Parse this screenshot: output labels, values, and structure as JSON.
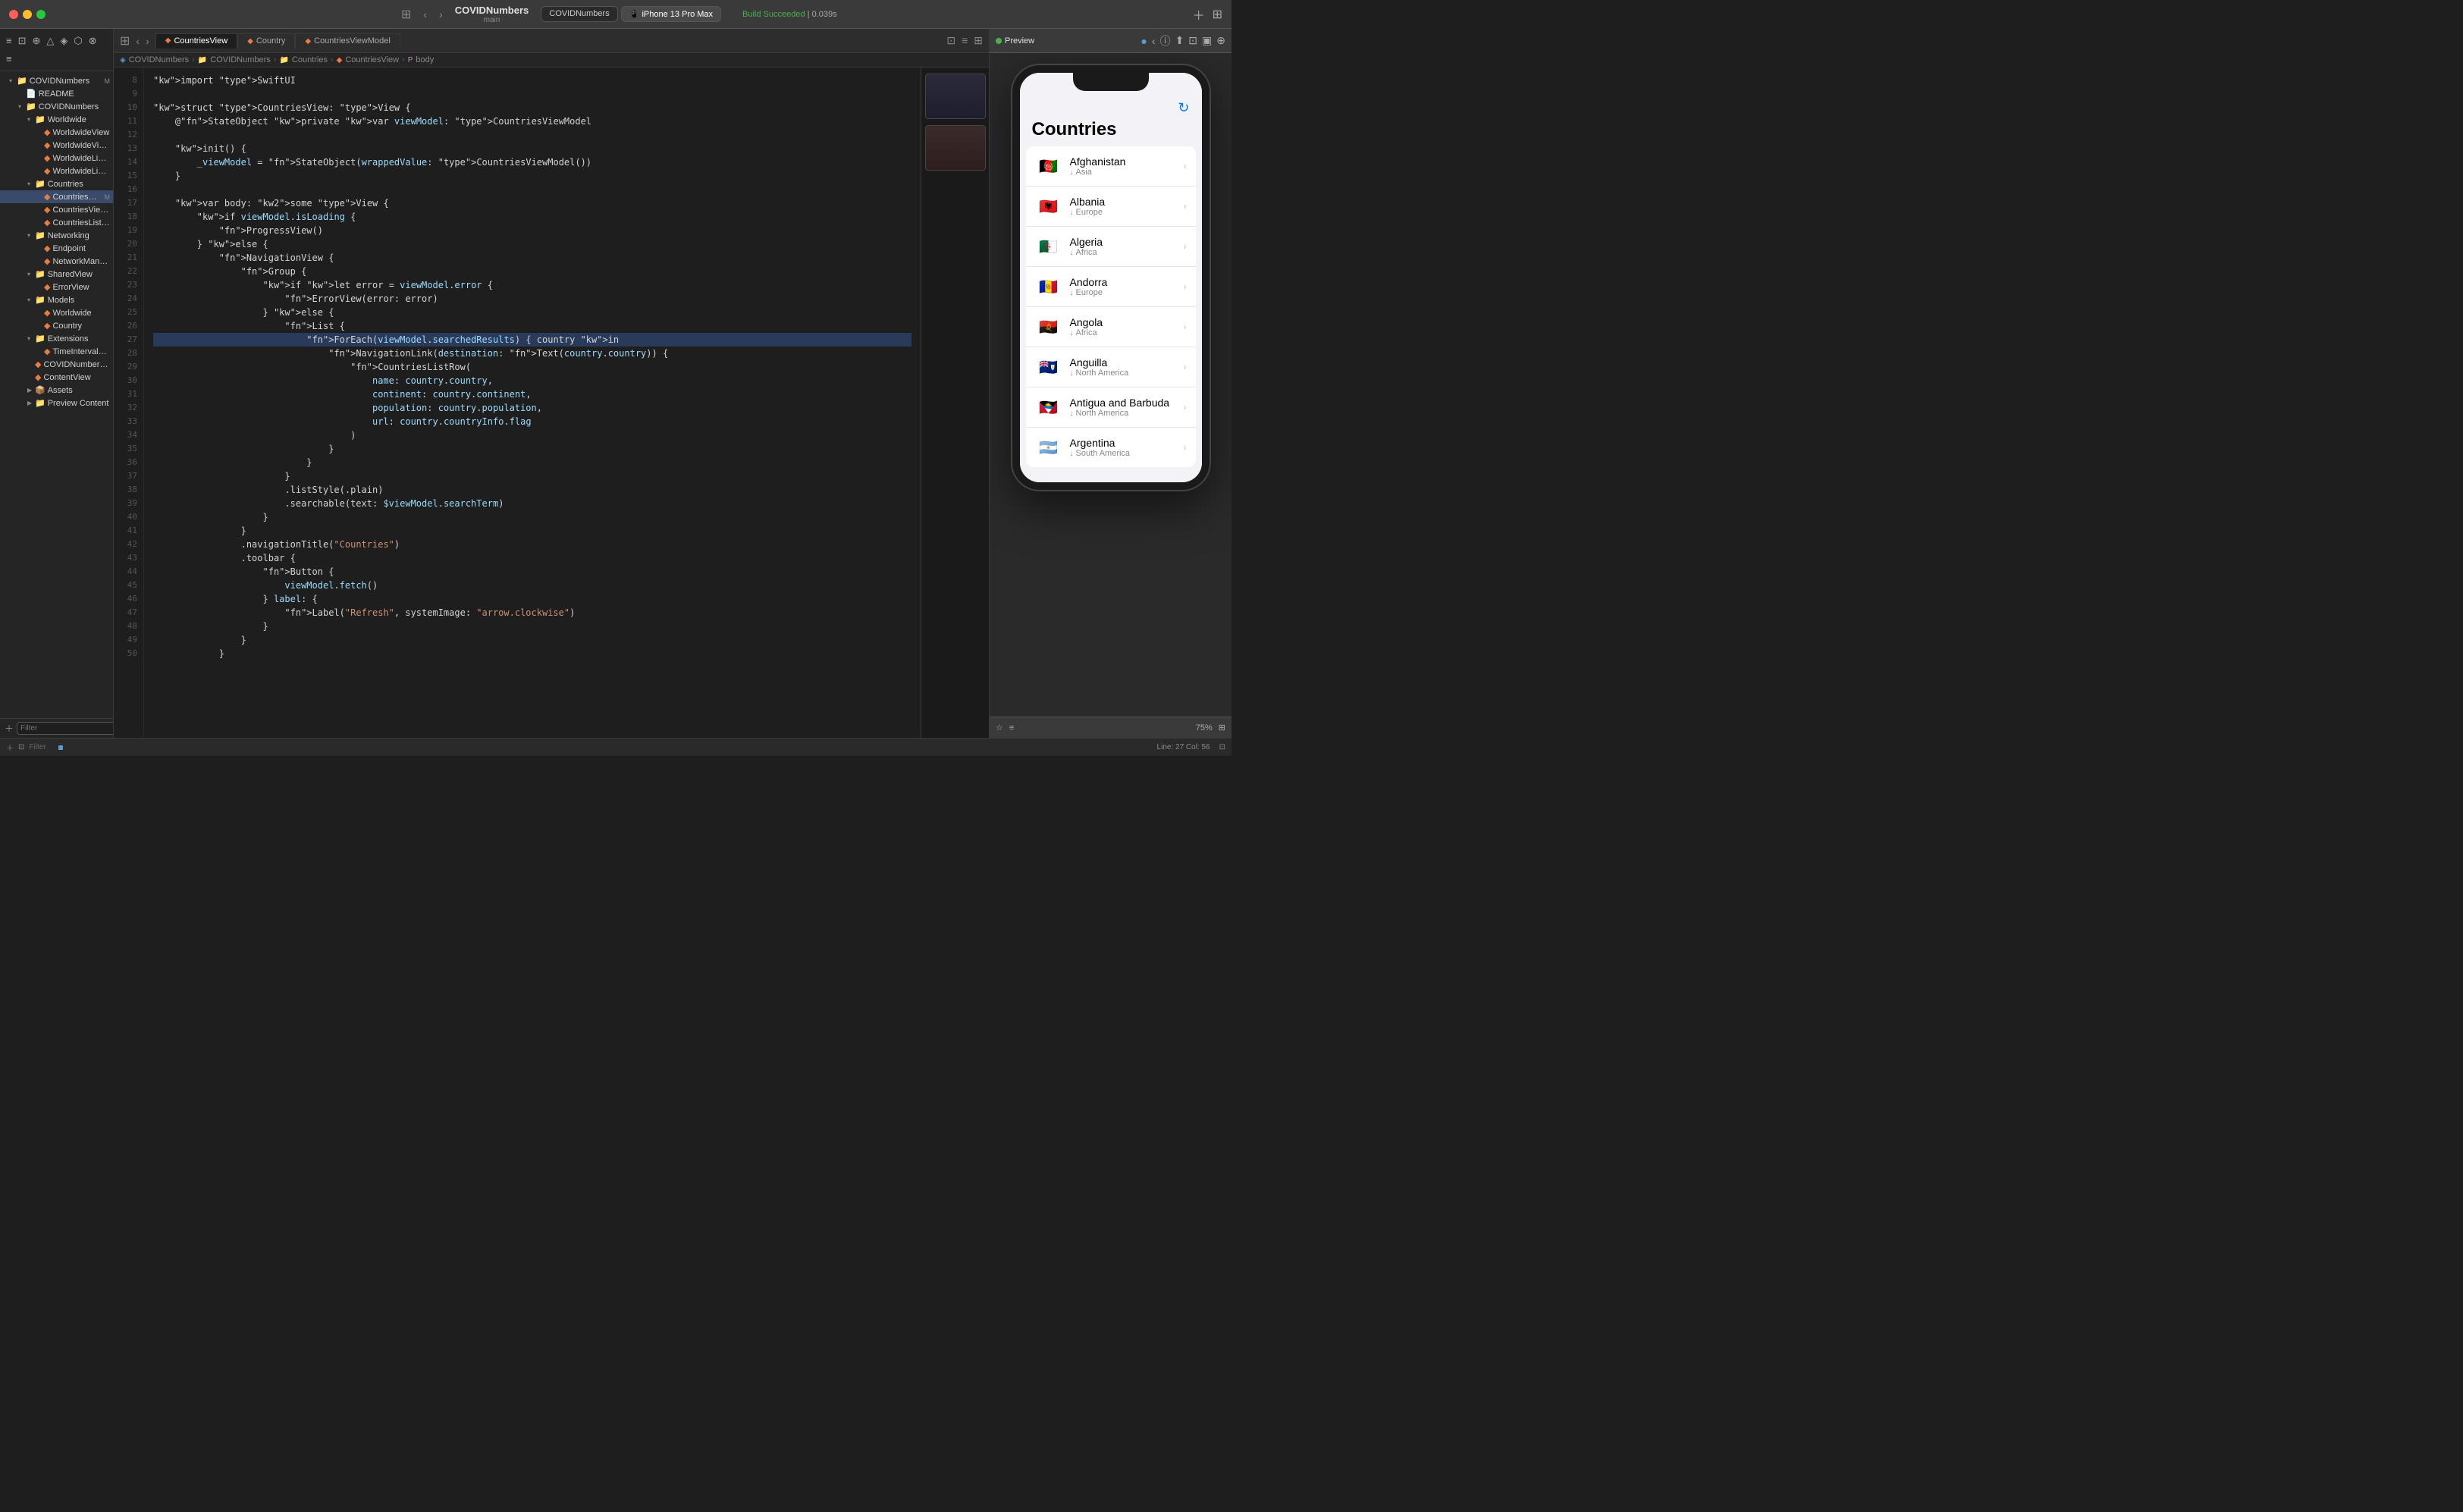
{
  "titleBar": {
    "trafficLights": [
      "close",
      "minimize",
      "maximize"
    ],
    "project": {
      "name": "COVIDNumbers",
      "sub": "main"
    },
    "tabs": [
      {
        "label": "COVIDNumbers",
        "active": false
      },
      {
        "label": "iPhone 13 Pro Max",
        "active": true
      }
    ],
    "buildStatus": "Build Succeeded | 0.039s",
    "icons": [
      "+",
      "⊞"
    ]
  },
  "sidebar": {
    "toolbar_icons": [
      "≡",
      "⊡",
      "⊞",
      "⊛",
      "◈",
      "△",
      "⊕",
      "⬡",
      "⊗",
      "≡"
    ],
    "tree": [
      {
        "level": 0,
        "type": "folder",
        "label": "COVIDNumbers",
        "badge": "M",
        "expanded": true
      },
      {
        "level": 1,
        "type": "file",
        "label": "README",
        "icon": "readme"
      },
      {
        "level": 1,
        "type": "folder",
        "label": "COVIDNumbers",
        "expanded": true
      },
      {
        "level": 2,
        "type": "folder",
        "label": "Worldwide",
        "expanded": true
      },
      {
        "level": 3,
        "type": "swift",
        "label": "WorldwideView"
      },
      {
        "level": 3,
        "type": "swift",
        "label": "WorldwideViewModel"
      },
      {
        "level": 3,
        "type": "swift",
        "label": "WorldwideListView"
      },
      {
        "level": 3,
        "type": "swift",
        "label": "WorldwideListRow"
      },
      {
        "level": 2,
        "type": "folder",
        "label": "Countries",
        "expanded": true
      },
      {
        "level": 3,
        "type": "swift",
        "label": "CountriesView",
        "badge": "M",
        "selected": true
      },
      {
        "level": 3,
        "type": "swift",
        "label": "CountriesViewModel"
      },
      {
        "level": 3,
        "type": "swift",
        "label": "CountriesListRow"
      },
      {
        "level": 2,
        "type": "folder",
        "label": "Networking",
        "expanded": true
      },
      {
        "level": 3,
        "type": "swift",
        "label": "Endpoint"
      },
      {
        "level": 3,
        "type": "swift",
        "label": "NetworkManager"
      },
      {
        "level": 2,
        "type": "folder",
        "label": "SharedView",
        "expanded": true
      },
      {
        "level": 3,
        "type": "swift",
        "label": "ErrorView"
      },
      {
        "level": 2,
        "type": "folder",
        "label": "Models",
        "expanded": true
      },
      {
        "level": 3,
        "type": "swift",
        "label": "Worldwide"
      },
      {
        "level": 3,
        "type": "swift",
        "label": "Country"
      },
      {
        "level": 2,
        "type": "folder",
        "label": "Extensions",
        "expanded": true
      },
      {
        "level": 3,
        "type": "swift",
        "label": "TimeInterval+String"
      },
      {
        "level": 2,
        "type": "swift",
        "label": "COVIDNumbersApp"
      },
      {
        "level": 2,
        "type": "swift",
        "label": "ContentView"
      },
      {
        "level": 2,
        "type": "folder",
        "label": "Assets"
      },
      {
        "level": 2,
        "type": "folder",
        "label": "Preview Content"
      }
    ],
    "filterPlaceholder": "Filter",
    "addIcon": "+",
    "filterIcon": "⊡"
  },
  "editorTabs": [
    {
      "label": "CountriesView",
      "active": true,
      "icon": "swift"
    },
    {
      "label": "Country",
      "active": false,
      "icon": "swift"
    },
    {
      "label": "CountriesViewModel",
      "active": false,
      "icon": "swift"
    }
  ],
  "breadcrumb": [
    "COVIDNumbers",
    "COVIDNumbers",
    "Countries",
    "CountriesView",
    "body"
  ],
  "codeLines": [
    {
      "num": 8,
      "content": "import SwiftUI",
      "highlight": false
    },
    {
      "num": 9,
      "content": "",
      "highlight": false
    },
    {
      "num": 10,
      "content": "struct CountriesView: View {",
      "highlight": false
    },
    {
      "num": 11,
      "content": "    @StateObject private var viewModel: CountriesViewModel",
      "highlight": false
    },
    {
      "num": 12,
      "content": "",
      "highlight": false
    },
    {
      "num": 13,
      "content": "    init() {",
      "highlight": false
    },
    {
      "num": 14,
      "content": "        _viewModel = StateObject(wrappedValue: CountriesViewModel())",
      "highlight": false
    },
    {
      "num": 15,
      "content": "    }",
      "highlight": false
    },
    {
      "num": 16,
      "content": "",
      "highlight": false
    },
    {
      "num": 17,
      "content": "    var body: some View {",
      "highlight": false
    },
    {
      "num": 18,
      "content": "        if viewModel.isLoading {",
      "highlight": false
    },
    {
      "num": 19,
      "content": "            ProgressView()",
      "highlight": false
    },
    {
      "num": 20,
      "content": "        } else {",
      "highlight": false
    },
    {
      "num": 21,
      "content": "            NavigationView {",
      "highlight": false
    },
    {
      "num": 22,
      "content": "                Group {",
      "highlight": false
    },
    {
      "num": 23,
      "content": "                    if let error = viewModel.error {",
      "highlight": false
    },
    {
      "num": 24,
      "content": "                        ErrorView(error: error)",
      "highlight": false
    },
    {
      "num": 25,
      "content": "                    } else {",
      "highlight": false
    },
    {
      "num": 26,
      "content": "                        List {",
      "highlight": false
    },
    {
      "num": 27,
      "content": "                            ForEach(viewModel.searchedResults) { country in",
      "highlight": true
    },
    {
      "num": 28,
      "content": "                                NavigationLink(destination: Text(country.country)) {",
      "highlight": false
    },
    {
      "num": 29,
      "content": "                                    CountriesListRow(",
      "highlight": false
    },
    {
      "num": 30,
      "content": "                                        name: country.country,",
      "highlight": false
    },
    {
      "num": 31,
      "content": "                                        continent: country.continent,",
      "highlight": false
    },
    {
      "num": 32,
      "content": "                                        population: country.population,",
      "highlight": false
    },
    {
      "num": 33,
      "content": "                                        url: country.countryInfo.flag",
      "highlight": false
    },
    {
      "num": 34,
      "content": "                                    )",
      "highlight": false
    },
    {
      "num": 35,
      "content": "                                }",
      "highlight": false
    },
    {
      "num": 36,
      "content": "                            }",
      "highlight": false
    },
    {
      "num": 37,
      "content": "                        }",
      "highlight": false
    },
    {
      "num": 38,
      "content": "                        .listStyle(.plain)",
      "highlight": false
    },
    {
      "num": 39,
      "content": "                        .searchable(text: $viewModel.searchTerm)",
      "highlight": false
    },
    {
      "num": 40,
      "content": "                    }",
      "highlight": false
    },
    {
      "num": 41,
      "content": "                }",
      "highlight": false
    },
    {
      "num": 42,
      "content": "                .navigationTitle(\"Countries\")",
      "highlight": false
    },
    {
      "num": 43,
      "content": "                .toolbar {",
      "highlight": false
    },
    {
      "num": 44,
      "content": "                    Button {",
      "highlight": false
    },
    {
      "num": 45,
      "content": "                        viewModel.fetch()",
      "highlight": false
    },
    {
      "num": 46,
      "content": "                    } label: {",
      "highlight": false
    },
    {
      "num": 47,
      "content": "                        Label(\"Refresh\", systemImage: \"arrow.clockwise\")",
      "highlight": false
    },
    {
      "num": 48,
      "content": "                    }",
      "highlight": false
    },
    {
      "num": 49,
      "content": "                }",
      "highlight": false
    },
    {
      "num": 50,
      "content": "            }",
      "highlight": false
    }
  ],
  "preview": {
    "status": "Preview",
    "statusColor": "#4caf50",
    "title": "Countries",
    "countries": [
      {
        "name": "Afghanistan",
        "continent": "Asia",
        "flag": "🇦🇫"
      },
      {
        "name": "Albania",
        "continent": "Europe",
        "flag": "🇦🇱"
      },
      {
        "name": "Algeria",
        "continent": "Africa",
        "flag": "🇩🇿"
      },
      {
        "name": "Andorra",
        "continent": "Europe",
        "flag": "🇦🇩"
      },
      {
        "name": "Angola",
        "continent": "Africa",
        "flag": "🇦🇴"
      },
      {
        "name": "Anguilla",
        "continent": "North America",
        "flag": "🇦🇮"
      },
      {
        "name": "Antigua and Barbuda",
        "continent": "North America",
        "flag": "🇦🇬"
      },
      {
        "name": "Argentina",
        "continent": "South America",
        "flag": "🇦🇷"
      }
    ],
    "zoomLevel": "75%"
  },
  "statusBar": {
    "leftIcons": [
      "+",
      "≡"
    ],
    "filterPlaceholder": "Filter",
    "rightText": "Line: 27  Col: 56",
    "rightIcon": "⊡"
  }
}
